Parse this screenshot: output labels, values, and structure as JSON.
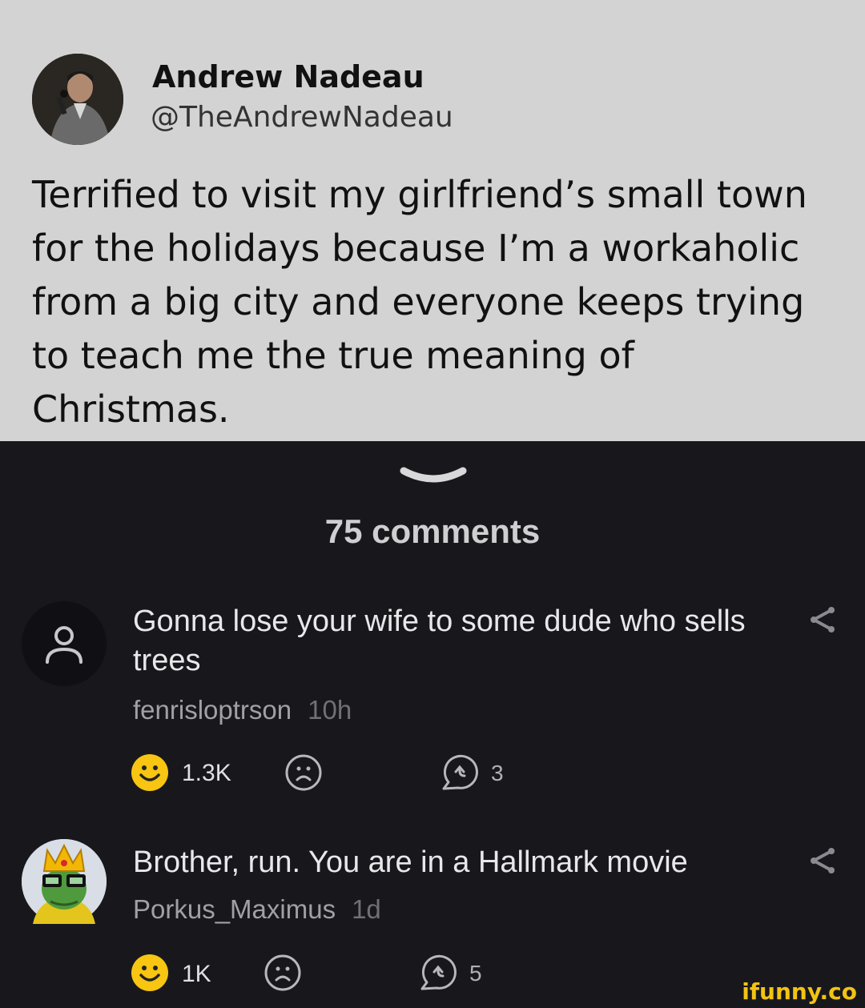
{
  "tweet": {
    "author_name": "Andrew Nadeau",
    "author_handle": "@TheAndrewNadeau",
    "text": "Terrified to visit my girlfriend’s small town for the holidays because I’m a workaholic from a big city and everyone keeps trying to teach me the true meaning of Christmas."
  },
  "comments_header": {
    "count_label": "75 comments"
  },
  "comments": [
    {
      "text": "Gonna lose your wife to some dude who sells trees",
      "username": "fenrisloptrson",
      "time": "10h",
      "smiles": "1.3K",
      "replies": "3"
    },
    {
      "text": "Brother, run. You are in a Hallmark movie",
      "username": "Porkus_Maximus",
      "time": "1d",
      "smiles": "1K",
      "replies": "5"
    }
  ],
  "watermark": "ifunny.co",
  "colors": {
    "smile_yellow": "#f7c512",
    "tweet_bg": "#d3d3d3",
    "app_bg": "#18181c"
  }
}
